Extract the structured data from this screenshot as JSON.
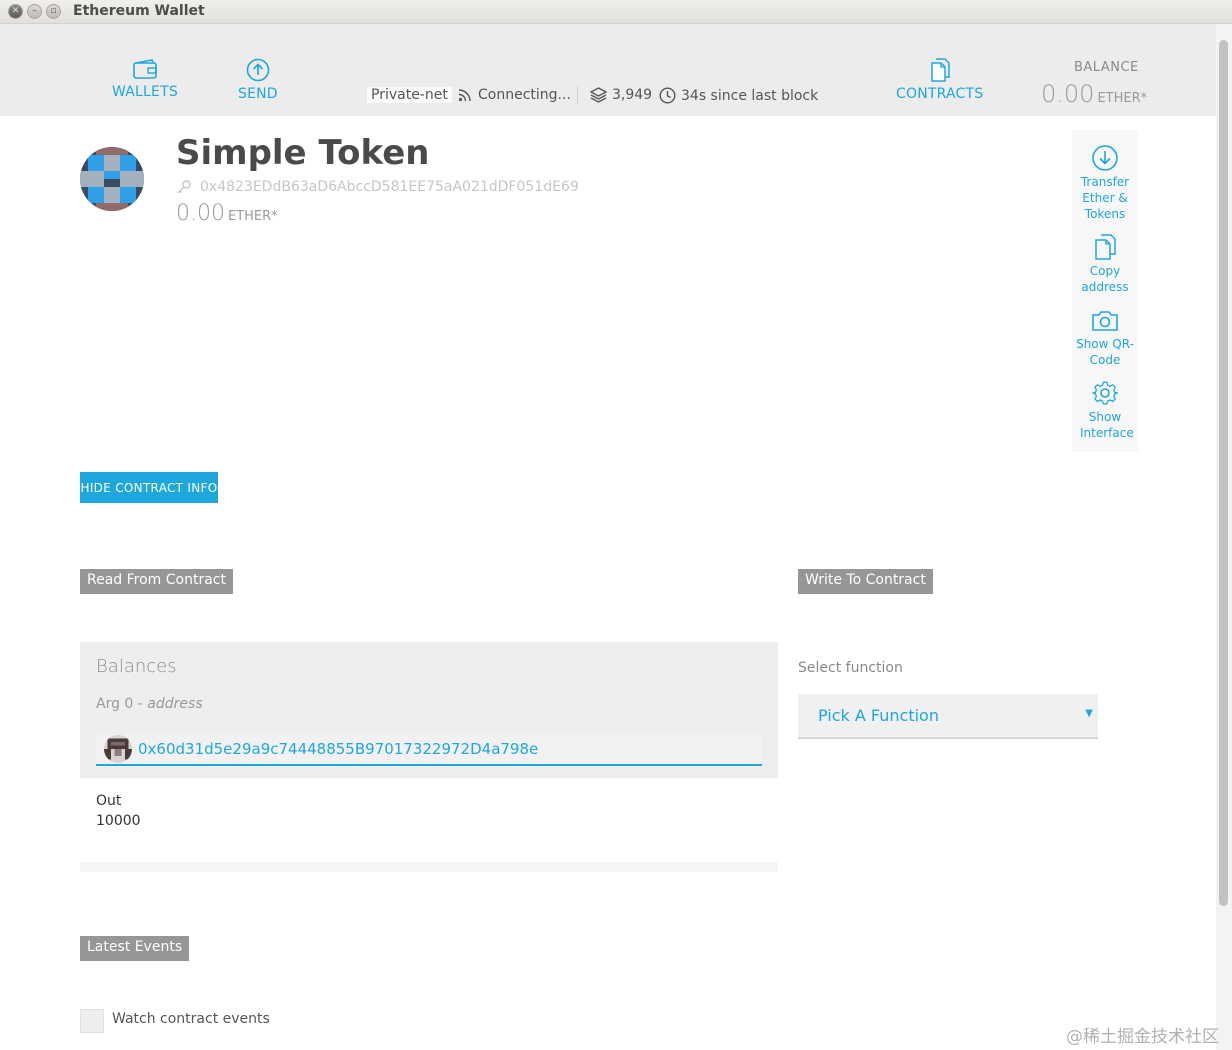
{
  "window": {
    "title": "Ethereum Wallet"
  },
  "header": {
    "nav": {
      "wallets": "WALLETS",
      "send": "SEND",
      "contracts": "CONTRACTS"
    },
    "status": {
      "network": "Private-net",
      "connection": "Connecting...",
      "block_number": "3,949",
      "since_last_block": "34s since last block"
    },
    "balance": {
      "label": "BALANCE",
      "value": "0.00",
      "unit": "ETHER*"
    }
  },
  "contract": {
    "name": "Simple Token",
    "address": "0x4823EDdB63aD6AbccD581EE75aA021dDF051dE69",
    "balance": "0.00",
    "unit": "ETHER*"
  },
  "actions": [
    {
      "label": "Transfer Ether & Tokens",
      "icon": "download-circle-icon"
    },
    {
      "label": "Copy address",
      "icon": "copy-icon"
    },
    {
      "label": "Show QR-Code",
      "icon": "camera-icon"
    },
    {
      "label": "Show Interface",
      "icon": "gear-icon"
    }
  ],
  "hide_button": "HIDE CONTRACT INFO",
  "read": {
    "tag": "Read From Contract",
    "function_name": "Balances",
    "arg_label": "Arg 0",
    "arg_type": "address",
    "arg_value": "0x60d31d5e29a9c74448855B97017322972D4a798e",
    "out_label": "Out",
    "out_value": "10000"
  },
  "write": {
    "tag": "Write To Contract",
    "select_label": "Select function",
    "selected": "Pick A Function"
  },
  "events": {
    "tag": "Latest Events",
    "watch_label": "Watch contract events"
  },
  "watermark": "@稀土掘金技术社区",
  "colors": {
    "accent": "#1ea7dd",
    "tag": "#969696",
    "header_bg": "#ececec"
  }
}
